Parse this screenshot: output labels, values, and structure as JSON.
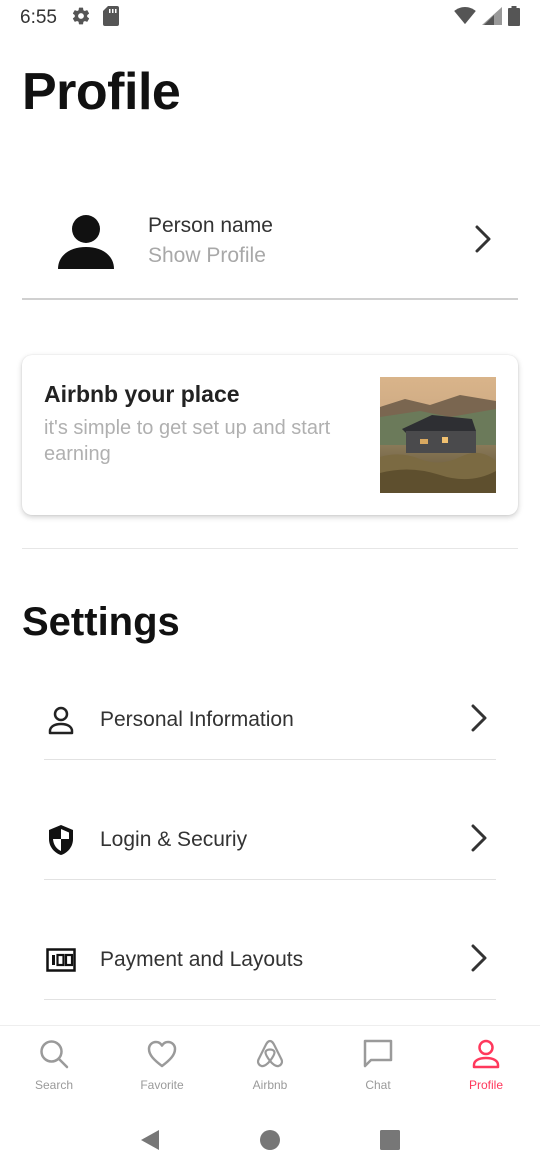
{
  "status_bar": {
    "time": "6:55",
    "icons_left": [
      "gear-icon",
      "sd-card-icon"
    ],
    "icons_right": [
      "wifi-icon",
      "signal-icon",
      "battery-icon"
    ]
  },
  "page": {
    "title": "Profile"
  },
  "profile": {
    "name": "Person name",
    "action": "Show Profile",
    "avatar_icon": "person-icon"
  },
  "promo": {
    "title": "Airbnb your place",
    "subtitle": "it's simple to get set up and start earning",
    "image": "house-photo"
  },
  "settings": {
    "title": "Settings",
    "items": [
      {
        "label": "Personal Information",
        "icon": "person-outline-icon"
      },
      {
        "label": "Login & Securiy",
        "icon": "shield-icon"
      },
      {
        "label": "Payment and Layouts",
        "icon": "money-icon"
      }
    ]
  },
  "bottom_nav": {
    "active": "Profile",
    "accent_color": "#ff385c",
    "inactive_color": "#9a9a9a",
    "items": [
      {
        "label": "Search",
        "icon": "search-icon"
      },
      {
        "label": "Favorite",
        "icon": "heart-icon"
      },
      {
        "label": "Airbnb",
        "icon": "airbnb-logo-icon"
      },
      {
        "label": "Chat",
        "icon": "chat-icon"
      },
      {
        "label": "Profile",
        "icon": "profile-icon"
      }
    ]
  },
  "system_nav": [
    "back-icon",
    "home-icon",
    "recents-icon"
  ]
}
